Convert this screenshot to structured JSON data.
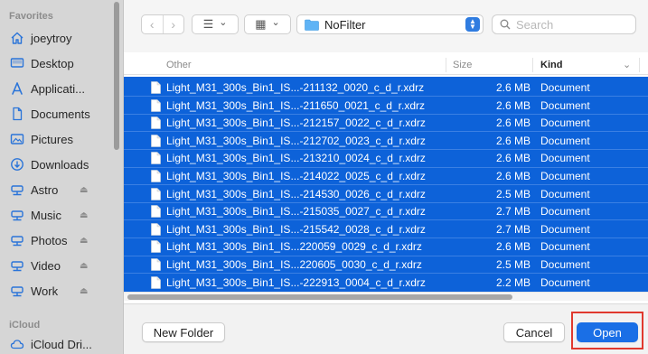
{
  "sidebar": {
    "favorites_label": "Favorites",
    "icloud_label": "iCloud",
    "items": [
      {
        "label": "joeytroy",
        "icon": "home-icon"
      },
      {
        "label": "Desktop",
        "icon": "desktop-icon"
      },
      {
        "label": "Applicati...",
        "icon": "applications-icon"
      },
      {
        "label": "Documents",
        "icon": "document-icon"
      },
      {
        "label": "Pictures",
        "icon": "pictures-icon"
      },
      {
        "label": "Downloads",
        "icon": "downloads-icon"
      },
      {
        "label": "Astro",
        "icon": "network-drive-icon",
        "eject": true
      },
      {
        "label": "Music",
        "icon": "network-drive-icon",
        "eject": true
      },
      {
        "label": "Photos",
        "icon": "network-drive-icon",
        "eject": true
      },
      {
        "label": "Video",
        "icon": "network-drive-icon",
        "eject": true
      },
      {
        "label": "Work",
        "icon": "network-drive-icon",
        "eject": true
      }
    ],
    "icloud_items": [
      {
        "label": "iCloud Dri...",
        "icon": "icloud-icon"
      }
    ],
    "eject_glyph": "⏏"
  },
  "toolbar": {
    "back_glyph": "‹",
    "forward_glyph": "›",
    "view_list_glyph": "☰",
    "view_grid_glyph": "▦",
    "dropdown_glyph": "⌄",
    "location": "NoFilter",
    "search_placeholder": "Search"
  },
  "list": {
    "columns": {
      "name": "Other",
      "size": "Size",
      "kind": "Kind"
    },
    "files": [
      {
        "name": "Light_M31_300s_Bin1_IS...-211132_0020_c_d_r.xdrz",
        "size": "2.6 MB",
        "kind": "Document"
      },
      {
        "name": "Light_M31_300s_Bin1_IS...-211650_0021_c_d_r.xdrz",
        "size": "2.6 MB",
        "kind": "Document"
      },
      {
        "name": "Light_M31_300s_Bin1_IS...-212157_0022_c_d_r.xdrz",
        "size": "2.6 MB",
        "kind": "Document"
      },
      {
        "name": "Light_M31_300s_Bin1_IS...-212702_0023_c_d_r.xdrz",
        "size": "2.6 MB",
        "kind": "Document"
      },
      {
        "name": "Light_M31_300s_Bin1_IS...-213210_0024_c_d_r.xdrz",
        "size": "2.6 MB",
        "kind": "Document"
      },
      {
        "name": "Light_M31_300s_Bin1_IS...-214022_0025_c_d_r.xdrz",
        "size": "2.6 MB",
        "kind": "Document"
      },
      {
        "name": "Light_M31_300s_Bin1_IS...-214530_0026_c_d_r.xdrz",
        "size": "2.5 MB",
        "kind": "Document"
      },
      {
        "name": "Light_M31_300s_Bin1_IS...-215035_0027_c_d_r.xdrz",
        "size": "2.7 MB",
        "kind": "Document"
      },
      {
        "name": "Light_M31_300s_Bin1_IS...-215542_0028_c_d_r.xdrz",
        "size": "2.7 MB",
        "kind": "Document"
      },
      {
        "name": "Light_M31_300s_Bin1_IS...220059_0029_c_d_r.xdrz",
        "size": "2.6 MB",
        "kind": "Document"
      },
      {
        "name": "Light_M31_300s_Bin1_IS...220605_0030_c_d_r.xdrz",
        "size": "2.5 MB",
        "kind": "Document"
      },
      {
        "name": "Light_M31_300s_Bin1_IS...-222913_0004_c_d_r.xdrz",
        "size": "2.2 MB",
        "kind": "Document"
      }
    ]
  },
  "footer": {
    "new_folder_label": "New Folder",
    "cancel_label": "Cancel",
    "open_label": "Open"
  },
  "colors": {
    "selection": "#0d62d9",
    "accent": "#1a6fe6",
    "focus_highlight": "#e0392e"
  }
}
